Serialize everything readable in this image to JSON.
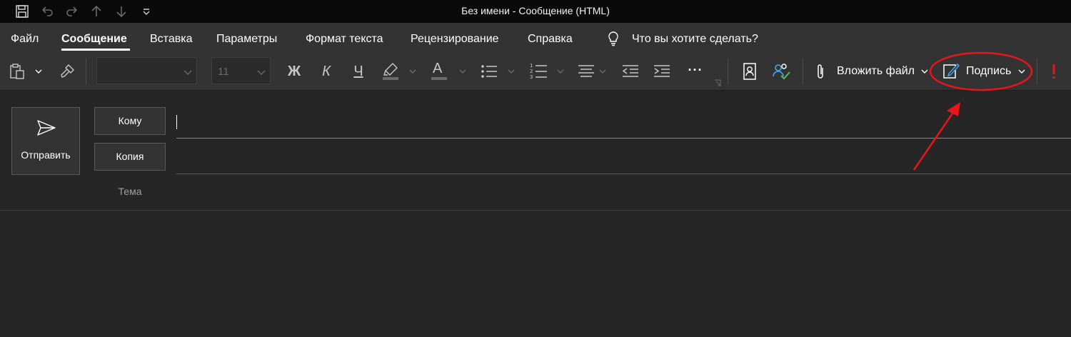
{
  "window": {
    "title": "Без имени  -  Сообщение (HTML)"
  },
  "ribbon": {
    "tabs": [
      "Файл",
      "Сообщение",
      "Вставка",
      "Параметры",
      "Формат текста",
      "Рецензирование",
      "Справка"
    ],
    "active_tab": "Сообщение",
    "tell_me": "Что вы хотите сделать?"
  },
  "toolbar": {
    "font_size": "11",
    "bold_label": "Ж",
    "italic_label": "К",
    "underline_label": "Ч",
    "font_color_label": "А",
    "more_label": "···",
    "attach_label": "Вложить файл",
    "signature_label": "Подпись",
    "icons": [
      "clipboard-icon",
      "format-painter-icon",
      "highlight-icon",
      "bullets-icon",
      "numbering-icon",
      "align-icon",
      "decrease-indent-icon",
      "increase-indent-icon",
      "address-book-icon",
      "check-names-icon",
      "paperclip-icon",
      "signature-icon",
      "importance-icon"
    ]
  },
  "compose": {
    "send_label": "Отправить",
    "to_label": "Кому",
    "cc_label": "Копия",
    "subject_label": "Тема",
    "to_value": "",
    "cc_value": ""
  },
  "colors": {
    "titlebar": "#0a0a0a",
    "ribbon": "#333333",
    "body": "#262626",
    "annotation": "#e8161b",
    "check_green": "#5bb85d",
    "person_blue": "#4aa6e8"
  }
}
